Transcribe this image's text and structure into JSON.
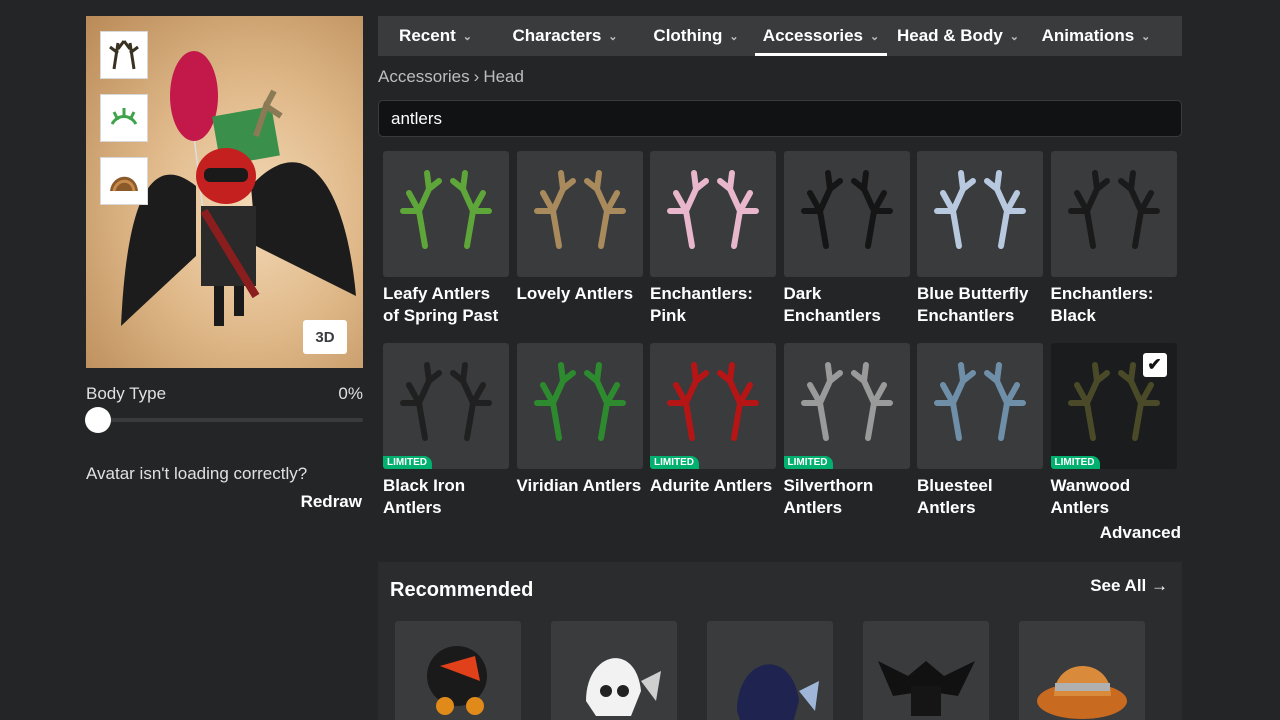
{
  "avatar": {
    "equipped": [
      {
        "icon": "antler-icon"
      },
      {
        "icon": "leaf-icon"
      },
      {
        "icon": "hair-icon"
      }
    ],
    "view_label": "3D",
    "body_type_label": "Body Type",
    "body_type_value": "0%",
    "body_type_fraction": 0.0,
    "loading_message": "Avatar isn't loading correctly?",
    "redraw_label": "Redraw"
  },
  "tabs": [
    {
      "label": "Recent",
      "active": false
    },
    {
      "label": "Characters",
      "active": false
    },
    {
      "label": "Clothing",
      "active": false
    },
    {
      "label": "Accessories",
      "active": true
    },
    {
      "label": "Head & Body",
      "active": false
    },
    {
      "label": "Animations",
      "active": false
    }
  ],
  "breadcrumb": {
    "parent": "Accessories",
    "separator": "›",
    "current": "Head"
  },
  "search": {
    "value": "antlers"
  },
  "items": [
    {
      "name": "Leafy Antlers of Spring Past",
      "limited": false,
      "selected": false,
      "color": "#5fa63a"
    },
    {
      "name": "Lovely Antlers",
      "limited": false,
      "selected": false,
      "color": "#a88a5c"
    },
    {
      "name": "Enchantlers: Pink",
      "limited": false,
      "selected": false,
      "color": "#e8b7cc"
    },
    {
      "name": "Dark Enchantlers",
      "limited": false,
      "selected": false,
      "color": "#151515"
    },
    {
      "name": "Blue Butterfly Enchantlers",
      "limited": false,
      "selected": false,
      "color": "#b8c8de"
    },
    {
      "name": "Enchantlers: Black",
      "limited": false,
      "selected": false,
      "color": "#1a1a1a"
    },
    {
      "name": "Black Iron Antlers",
      "limited": true,
      "selected": false,
      "color": "#202020"
    },
    {
      "name": "Viridian Antlers",
      "limited": false,
      "selected": false,
      "color": "#2e8a2e"
    },
    {
      "name": "Adurite Antlers",
      "limited": true,
      "selected": false,
      "color": "#b51515"
    },
    {
      "name": "Silverthorn Antlers",
      "limited": true,
      "selected": false,
      "color": "#9a9a9a"
    },
    {
      "name": "Bluesteel Antlers",
      "limited": false,
      "selected": false,
      "color": "#6f8fa8"
    },
    {
      "name": "Wanwood Antlers",
      "limited": true,
      "selected": true,
      "color": "#4a4a28"
    }
  ],
  "limited_label": "LIMITED",
  "advanced_label": "Advanced",
  "recommended": {
    "title": "Recommended",
    "see_all": "See All →",
    "items": [
      {
        "icon": "dominus-red-icon"
      },
      {
        "icon": "dominus-white-icon"
      },
      {
        "icon": "dominus-blue-icon"
      },
      {
        "icon": "bat-hat-icon"
      },
      {
        "icon": "orange-fedora-icon"
      }
    ]
  },
  "colors": {
    "background": "#232527",
    "panel": "#393b3d",
    "limited": "#00b06f"
  }
}
